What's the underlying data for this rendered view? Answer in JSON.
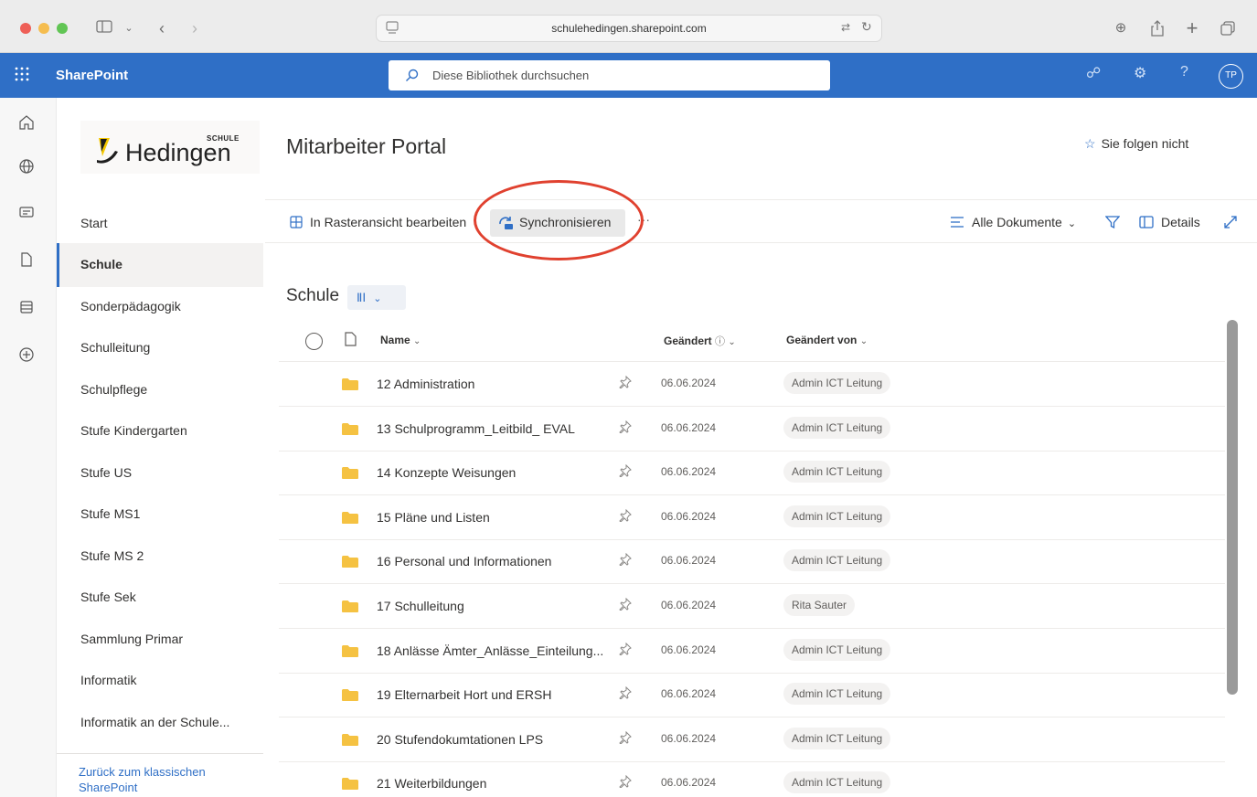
{
  "browser": {
    "url": "schulehedingen.sharepoint.com"
  },
  "suitebar": {
    "brand": "SharePoint",
    "search_placeholder": "Diese Bibliothek durchsuchen",
    "avatar_initials": "TP"
  },
  "site": {
    "logo_small": "SCHULE",
    "logo_text": "Hedingen",
    "title": "Mitarbeiter Portal",
    "follow_label": "Sie folgen nicht"
  },
  "nav": {
    "items": [
      {
        "label": "Start"
      },
      {
        "label": "Schule"
      },
      {
        "label": "Sonderpädagogik"
      },
      {
        "label": "Schulleitung"
      },
      {
        "label": "Schulpflege"
      },
      {
        "label": "Stufe Kindergarten"
      },
      {
        "label": "Stufe US"
      },
      {
        "label": "Stufe MS1"
      },
      {
        "label": "Stufe MS 2"
      },
      {
        "label": "Stufe Sek"
      },
      {
        "label": "Sammlung Primar"
      },
      {
        "label": "Informatik"
      },
      {
        "label": "Informatik an der Schule..."
      }
    ],
    "selected": "Schule",
    "classic_link": "Zurück zum klassischen SharePoint"
  },
  "commandbar": {
    "grid_edit": "In Rasteransicht bearbeiten",
    "sync": "Synchronisieren",
    "more": "···",
    "view": "Alle Dokumente",
    "details": "Details"
  },
  "library": {
    "title": "Schule",
    "columns": {
      "name": "Name",
      "modified": "Geändert",
      "modified_by": "Geändert von"
    },
    "rows": [
      {
        "name": "12 Administration",
        "modified": "06.06.2024",
        "modified_by": "Admin ICT Leitung"
      },
      {
        "name": "13 Schulprogramm_Leitbild_ EVAL",
        "modified": "06.06.2024",
        "modified_by": "Admin ICT Leitung"
      },
      {
        "name": "14 Konzepte Weisungen",
        "modified": "06.06.2024",
        "modified_by": "Admin ICT Leitung"
      },
      {
        "name": "15 Pläne und Listen",
        "modified": "06.06.2024",
        "modified_by": "Admin ICT Leitung"
      },
      {
        "name": "16 Personal und Informationen",
        "modified": "06.06.2024",
        "modified_by": "Admin ICT Leitung"
      },
      {
        "name": "17 Schulleitung",
        "modified": "06.06.2024",
        "modified_by": "Rita Sauter"
      },
      {
        "name": "18 Anlässe Ämter_Anlässe_Einteilung...",
        "modified": "06.06.2024",
        "modified_by": "Admin ICT Leitung"
      },
      {
        "name": "19 Elternarbeit Hort und ERSH",
        "modified": "06.06.2024",
        "modified_by": "Admin ICT Leitung"
      },
      {
        "name": "20 Stufendokumtationen LPS",
        "modified": "06.06.2024",
        "modified_by": "Admin ICT Leitung"
      },
      {
        "name": "21 Weiterbildungen",
        "modified": "06.06.2024",
        "modified_by": "Admin ICT Leitung"
      }
    ]
  },
  "colors": {
    "accent": "#2f6fc6",
    "highlight_circle": "#e0412f",
    "folder": "#f5c242"
  }
}
